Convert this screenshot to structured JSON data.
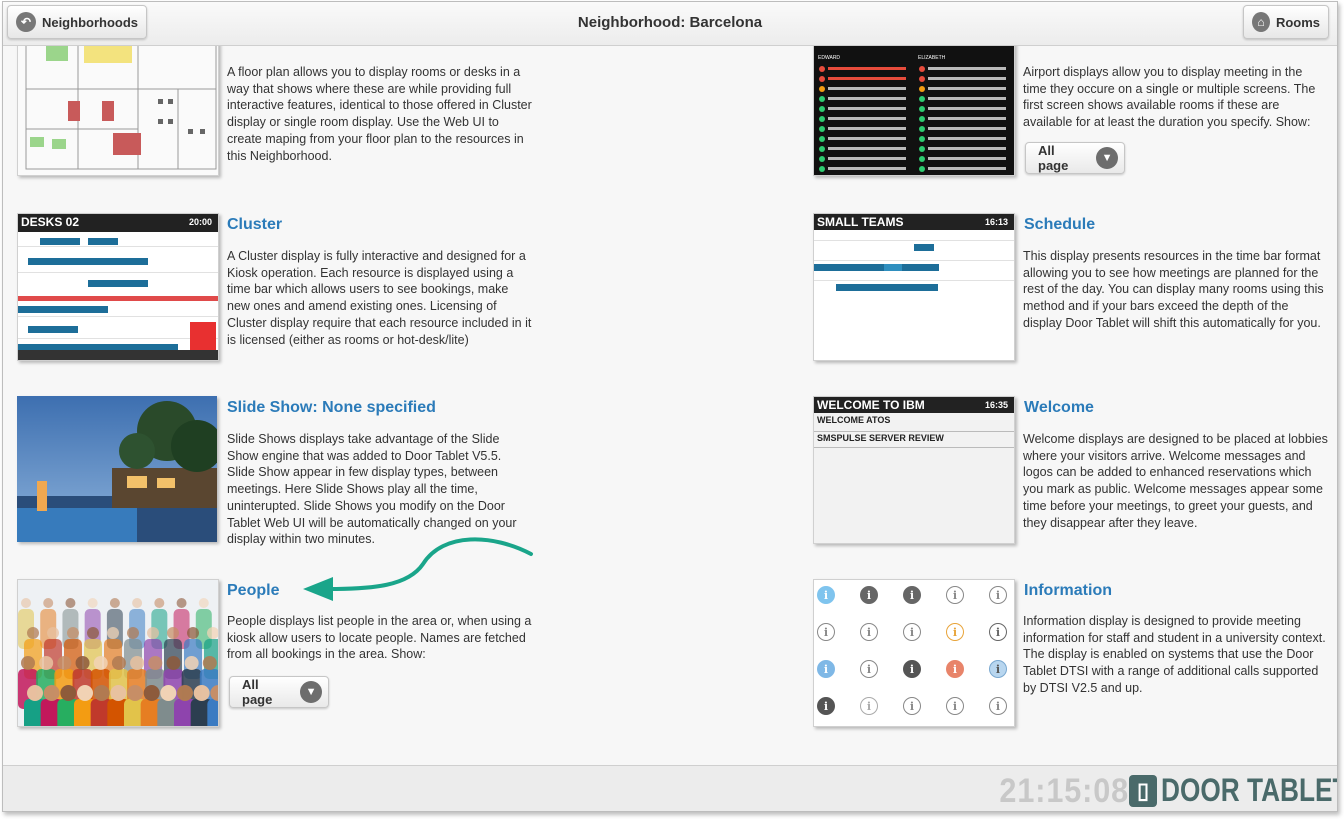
{
  "header": {
    "back_label": "Neighborhoods",
    "title": "Neighborhood: Barcelona",
    "home_label": "Rooms"
  },
  "cards": {
    "floorplan": {
      "description": "A floor plan allows you to display rooms or desks in a way that shows where these are while providing full interactive features, identical to those offered in Cluster display or single room display. Use the Web UI to create maping from your floor plan to the resources in this Neighborhood."
    },
    "airport": {
      "description": "Airport displays allow you to display meeting in the time they occure on a single or multiple screens. The first screen shows available rooms if these are available for at least the duration you specify. Show:",
      "dropdown_value": "All page"
    },
    "cluster": {
      "title": "Cluster",
      "description": "A Cluster display is fully interactive and designed for a Kiosk operation. Each resource is displayed using a time bar which allows users to see bookings, make new ones and amend existing ones. Licensing of Cluster display require that each resource included in it is licensed (either as rooms or hot-desk/lite)",
      "thumb_title": "DESKS 02",
      "thumb_time": "20:00"
    },
    "schedule": {
      "title": "Schedule",
      "description": "This display presents resources in the time bar format allowing you to see how meetings are planned for the rest of the day. You can display many rooms using this method and if your bars exceed the depth of the display Door Tablet will shift this automatically for you.",
      "thumb_title": "SMALL TEAMS",
      "thumb_time": "16:13"
    },
    "slideshow": {
      "title": "Slide Show: None specified",
      "description": "Slide Shows displays take advantage of the Slide Show engine that was added to Door Tablet V5.5. Slide Show appear in few display types, between meetings. Here Slide Shows play all the time, uninterupted. Slide Shows you modify on the Door Tablet Web UI will be automatically changed on your display within two minutes."
    },
    "welcome": {
      "title": "Welcome",
      "description": "Welcome displays are designed to be placed at lobbies where your visitors arrive. Welcome messages and logos can be added to enhanced reservations which you mark as public. Welcome messages appear some time before your meetings, to greet your guests, and they disappear after they leave.",
      "thumb_title": "WELCOME TO IBM",
      "thumb_time": "16:35",
      "thumb_line1": "WELCOME ATOS",
      "thumb_line2": "SMSPULSE SERVER REVIEW"
    },
    "people": {
      "title": "People",
      "description": "People displays list people in the area or, when using a kiosk allow users to locate people. Names are fetched from all bookings in the area. Show:",
      "dropdown_value": "All page"
    },
    "information": {
      "title": "Information",
      "description": "Information display is designed to provide meeting information for staff and student in a university context. The display is enabled on systems that use the Door Tablet DTSI with a range of additional calls supported by DTSI V2.5 and up."
    }
  },
  "footer": {
    "clock": "21:15:08",
    "brand": "DOOR TABLET"
  },
  "colors": {
    "title_blue": "#2b7bb9",
    "arrow_green": "#1aa58a",
    "bar_blue": "#1d6e99"
  }
}
